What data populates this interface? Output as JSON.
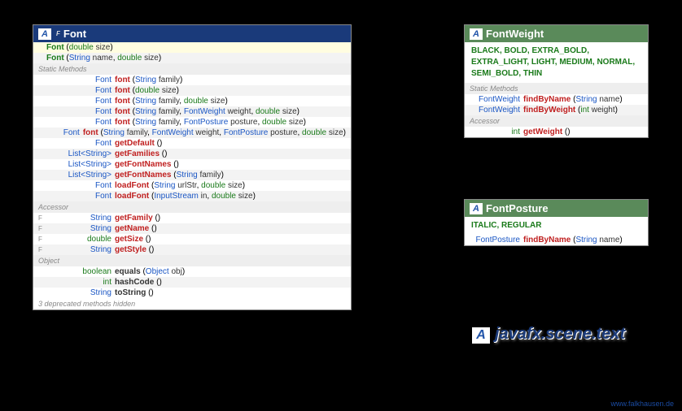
{
  "package": "javafx.scene.text",
  "credit": "www.falkhausen.de",
  "font": {
    "title": "Font",
    "marker": "F",
    "ctors": [
      {
        "name": "Font",
        "params": [
          {
            "t": "double",
            "n": "size"
          }
        ]
      },
      {
        "name": "Font",
        "params": [
          {
            "t": "String",
            "n": "name"
          },
          {
            "t": "double",
            "n": "size"
          }
        ]
      }
    ],
    "secStatic": "Static Methods",
    "static": [
      {
        "ret": "Font",
        "name": "font",
        "params": [
          {
            "t": "String",
            "n": "family"
          }
        ]
      },
      {
        "ret": "Font",
        "name": "font",
        "params": [
          {
            "t": "double",
            "n": "size"
          }
        ]
      },
      {
        "ret": "Font",
        "name": "font",
        "params": [
          {
            "t": "String",
            "n": "family"
          },
          {
            "t": "double",
            "n": "size"
          }
        ]
      },
      {
        "ret": "Font",
        "name": "font",
        "params": [
          {
            "t": "String",
            "n": "family"
          },
          {
            "t": "FontWeight",
            "n": "weight"
          },
          {
            "t": "double",
            "n": "size"
          }
        ]
      },
      {
        "ret": "Font",
        "name": "font",
        "params": [
          {
            "t": "String",
            "n": "family"
          },
          {
            "t": "FontPosture",
            "n": "posture"
          },
          {
            "t": "double",
            "n": "size"
          }
        ]
      },
      {
        "ret": "Font",
        "name": "font",
        "params": [
          {
            "t": "String",
            "n": "family"
          },
          {
            "t": "FontWeight",
            "n": "weight"
          },
          {
            "t": "FontPosture",
            "n": "posture"
          },
          {
            "t": "double",
            "n": "size"
          }
        ]
      },
      {
        "ret": "Font",
        "name": "getDefault",
        "params": []
      },
      {
        "ret": "List<String>",
        "name": "getFamilies",
        "params": []
      },
      {
        "ret": "List<String>",
        "name": "getFontNames",
        "params": []
      },
      {
        "ret": "List<String>",
        "name": "getFontNames",
        "params": [
          {
            "t": "String",
            "n": "family"
          }
        ]
      },
      {
        "ret": "Font",
        "name": "loadFont",
        "params": [
          {
            "t": "String",
            "n": "urlStr"
          },
          {
            "t": "double",
            "n": "size"
          }
        ]
      },
      {
        "ret": "Font",
        "name": "loadFont",
        "params": [
          {
            "t": "InputStream",
            "n": "in"
          },
          {
            "t": "double",
            "n": "size"
          }
        ]
      }
    ],
    "secAcc": "Accessor",
    "acc": [
      {
        "flag": "F",
        "ret": "String",
        "name": "getFamily",
        "params": []
      },
      {
        "flag": "F",
        "ret": "String",
        "name": "getName",
        "params": []
      },
      {
        "flag": "F",
        "ret": "double",
        "name": "getSize",
        "params": []
      },
      {
        "flag": "F",
        "ret": "String",
        "name": "getStyle",
        "params": []
      }
    ],
    "secObj": "Object",
    "obj": [
      {
        "ret": "boolean",
        "name": "equals",
        "params": [
          {
            "t": "Object",
            "n": "obj"
          }
        ]
      },
      {
        "ret": "int",
        "name": "hashCode",
        "params": []
      },
      {
        "ret": "String",
        "name": "toString",
        "params": []
      }
    ],
    "deprecated": "3 deprecated methods hidden"
  },
  "weight": {
    "title": "FontWeight",
    "constants": "BLACK, BOLD, EXTRA_BOLD, EXTRA_LIGHT, LIGHT, MEDIUM, NORMAL, SEMI_BOLD, THIN",
    "secStatic": "Static Methods",
    "static": [
      {
        "ret": "FontWeight",
        "name": "findByName",
        "params": [
          {
            "t": "String",
            "n": "name"
          }
        ]
      },
      {
        "ret": "FontWeight",
        "name": "findByWeight",
        "params": [
          {
            "t": "int",
            "n": "weight"
          }
        ]
      }
    ],
    "secAcc": "Accessor",
    "acc": [
      {
        "ret": "int",
        "name": "getWeight",
        "params": []
      }
    ]
  },
  "posture": {
    "title": "FontPosture",
    "constants": "ITALIC, REGULAR",
    "static": [
      {
        "ret": "FontPosture",
        "name": "findByName",
        "params": [
          {
            "t": "String",
            "n": "name"
          }
        ]
      }
    ]
  }
}
